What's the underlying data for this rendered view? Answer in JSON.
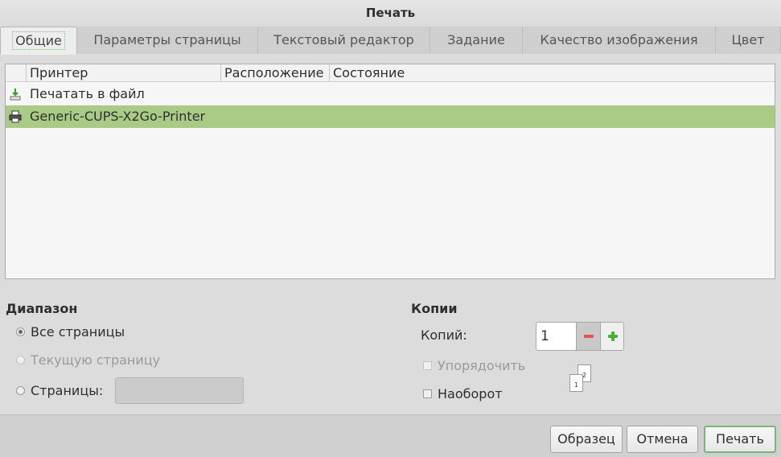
{
  "window": {
    "title": "Печать"
  },
  "tabs": [
    {
      "label": "Общие",
      "active": true
    },
    {
      "label": "Параметры страницы"
    },
    {
      "label": "Текстовый редактор"
    },
    {
      "label": "Задание"
    },
    {
      "label": "Качество изображения"
    },
    {
      "label": "Цвет"
    }
  ],
  "printer_list": {
    "columns": [
      "Принтер",
      "Расположение",
      "Состояние"
    ],
    "rows": [
      {
        "name": "Печатать в файл",
        "icon": "print-to-file-icon"
      },
      {
        "name": "Generic-CUPS-X2Go-Printer",
        "icon": "printer-icon",
        "selected": true
      }
    ]
  },
  "range": {
    "title": "Диапазон",
    "all_pages": "Все страницы",
    "current_page": "Текущую страницу",
    "pages": "Страницы:",
    "pages_value": ""
  },
  "copies": {
    "title": "Копии",
    "label": "Копий:",
    "value": "1",
    "collate": "Упорядочить",
    "reverse": "Наоборот",
    "preview_page_1": "1",
    "preview_page_2": "2"
  },
  "buttons": {
    "preview": "Образец",
    "cancel": "Отмена",
    "print": "Печать"
  },
  "colors": {
    "selection": "#a9cb86",
    "accent_border": "#79b478",
    "minus": "#e0564f",
    "plus": "#4caf35"
  }
}
